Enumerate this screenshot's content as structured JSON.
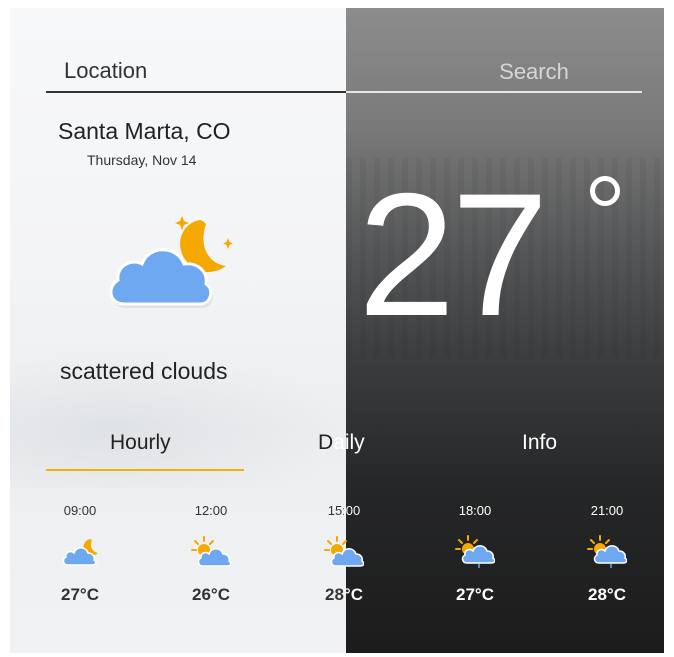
{
  "header": {
    "location_label": "Location",
    "search_placeholder": "Search"
  },
  "current": {
    "city": "Santa Marta, CO",
    "date": "Thursday, Nov 14",
    "temperature": "27",
    "description": "scattered clouds",
    "icon": "cloud-moon-icon"
  },
  "tabs": {
    "hourly": "Hourly",
    "daily_part1": "D",
    "daily_part2": "aily",
    "info": "Info",
    "active": "hourly"
  },
  "hourly": [
    {
      "time": "09:00",
      "temp": "27°C",
      "icon": "cloud-moon-icon"
    },
    {
      "time": "12:00",
      "temp": "26°C",
      "icon": "cloud-sun-icon"
    },
    {
      "time": "15:00",
      "temp": "28°C",
      "icon": "cloud-sun-icon"
    },
    {
      "time": "18:00",
      "temp": "27°C",
      "icon": "cloud-sun-rain-icon"
    },
    {
      "time": "21:00",
      "temp": "28°C",
      "icon": "cloud-sun-rain-icon"
    }
  ],
  "colors": {
    "accent": "#f0b400",
    "cloud": "#6ea8f0",
    "sun": "#f5a800"
  }
}
